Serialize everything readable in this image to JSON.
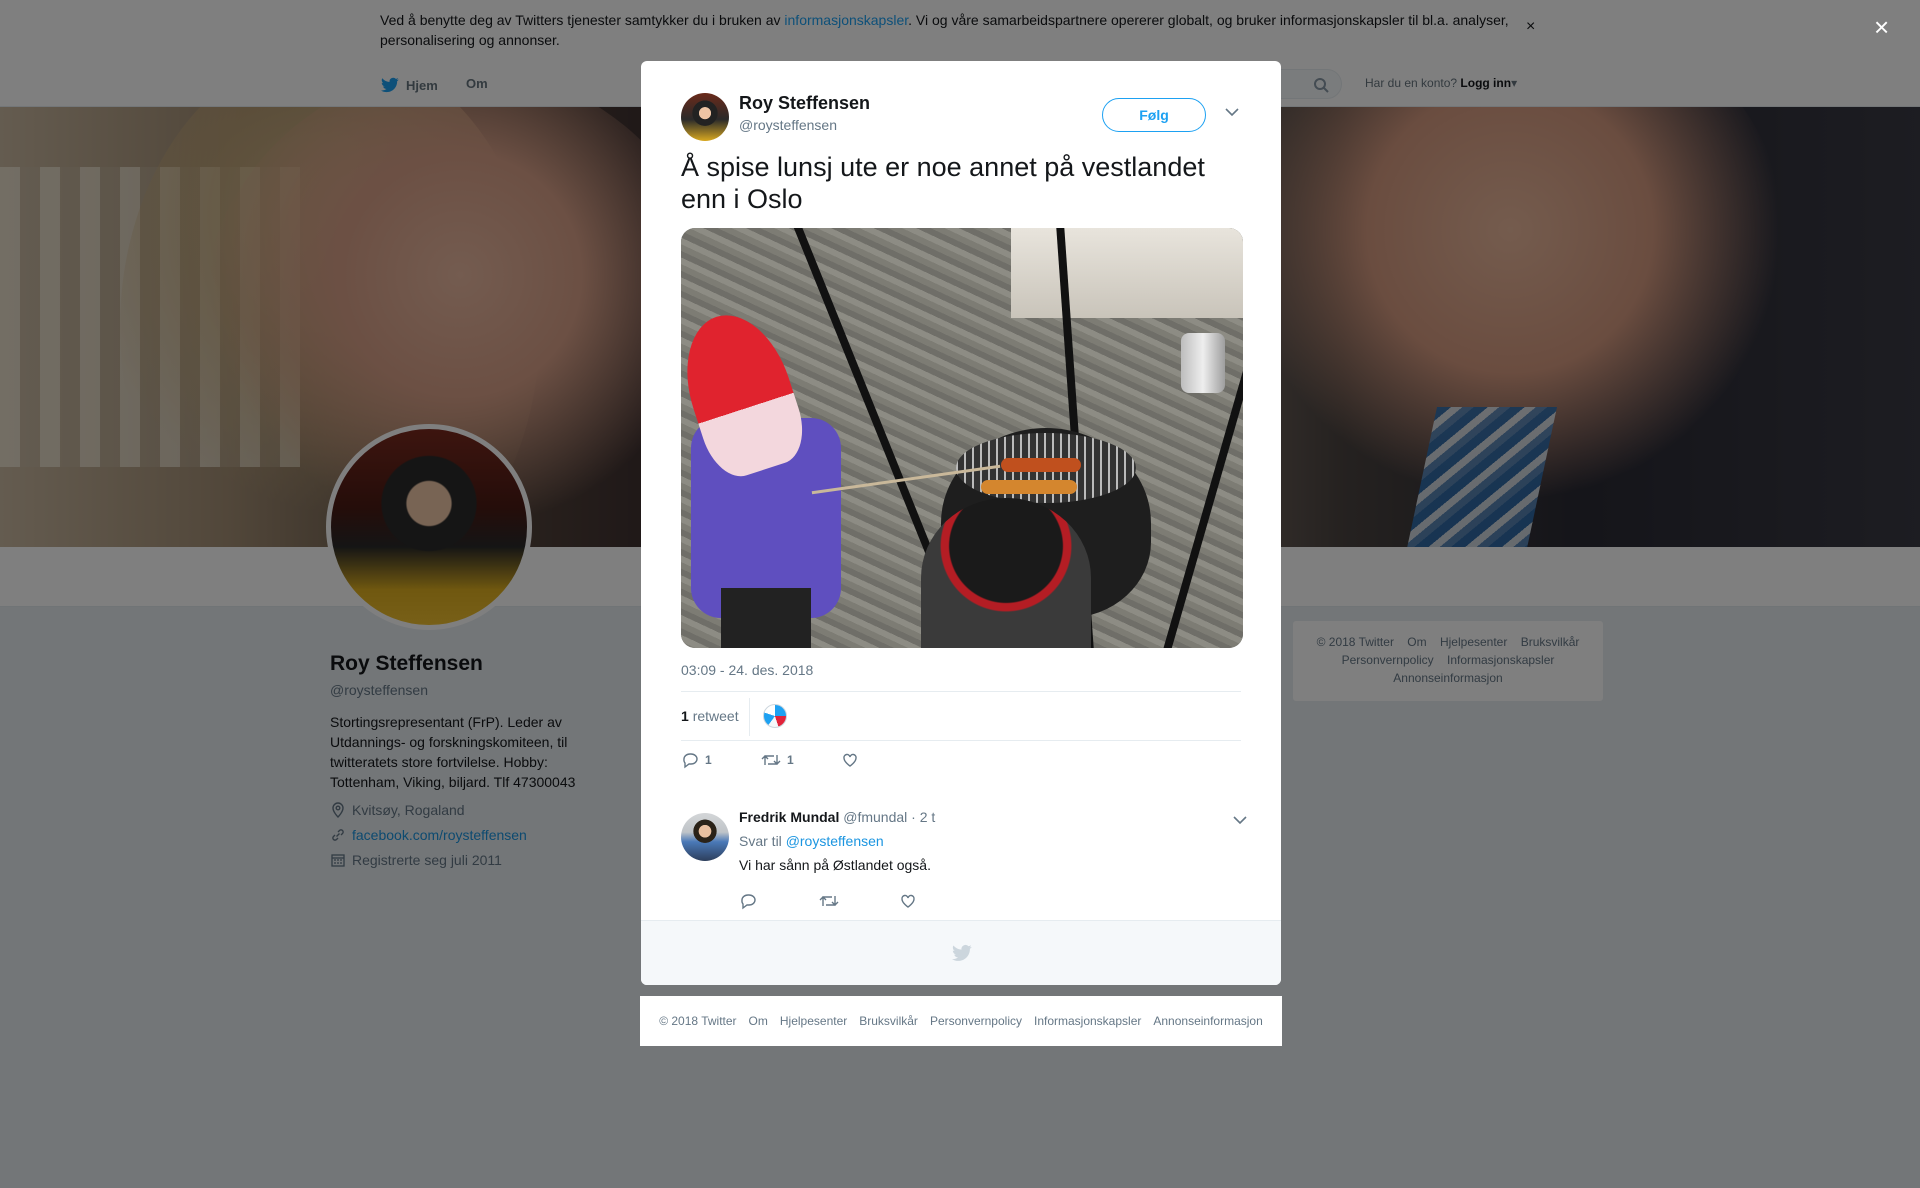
{
  "cookie_bar": {
    "text_before": "Ved å benytte deg av Twitters tjenester samtykker du i bruken av ",
    "link": "informasjonskapsler",
    "text_after": ". Vi og våre samarbeidspartnere opererer globalt, og bruker informasjonskapsler til bl.a. analyser, personalisering og annonser.",
    "close": "×"
  },
  "nav": {
    "home": "Hjem",
    "about": "Om",
    "account_prompt": "Har du en konto?",
    "login": "Logg inn"
  },
  "profile": {
    "name": "Roy Steffensen",
    "handle": "@roysteffensen",
    "bio": "Stortingsrepresentant (FrP). Leder av Utdannings- og forskningskomiteen, til twitteratets store fortvilelse. Hobby: Tottenham, Viking, biljard. Tlf 47300043",
    "location": "Kvitsøy, Rogaland",
    "website": "facebook.com/roysteffensen",
    "joined": "Registrerte seg juli 2011"
  },
  "side_footer": {
    "links": [
      "© 2018 Twitter",
      "Om",
      "Hjelpesenter",
      "Bruksvilkår",
      "Personvernpolicy",
      "Informasjonskapsler",
      "Annonseinformasjon"
    ]
  },
  "overlay": {
    "close": "×"
  },
  "tweet": {
    "author_name": "Roy Steffensen",
    "author_handle": "@roysteffensen",
    "follow_label": "Følg",
    "text": "Å spise lunsj ute er noe annet på vestlandet enn i Oslo",
    "timestamp": "03:09 - 24. des. 2018",
    "retweet_count": "1",
    "retweet_label": "retweet",
    "reply_count": "1",
    "retweet_action_count": "1",
    "like_count": ""
  },
  "reply": {
    "author_name": "Fredrik Mundal",
    "author_handle": "@fmundal",
    "time": "· 2 t",
    "reply_to_label": "Svar til",
    "reply_to_handle": "@roysteffensen",
    "text": "Vi har sånn på Østlandet også."
  },
  "footer": {
    "links": [
      "© 2018 Twitter",
      "Om",
      "Hjelpesenter",
      "Bruksvilkår",
      "Personvernpolicy",
      "Informasjonskapsler",
      "Annonseinformasjon"
    ]
  },
  "colors": {
    "twitter_blue": "#1da1f2",
    "link_blue": "#1b95e0",
    "secondary_text": "#657786"
  }
}
